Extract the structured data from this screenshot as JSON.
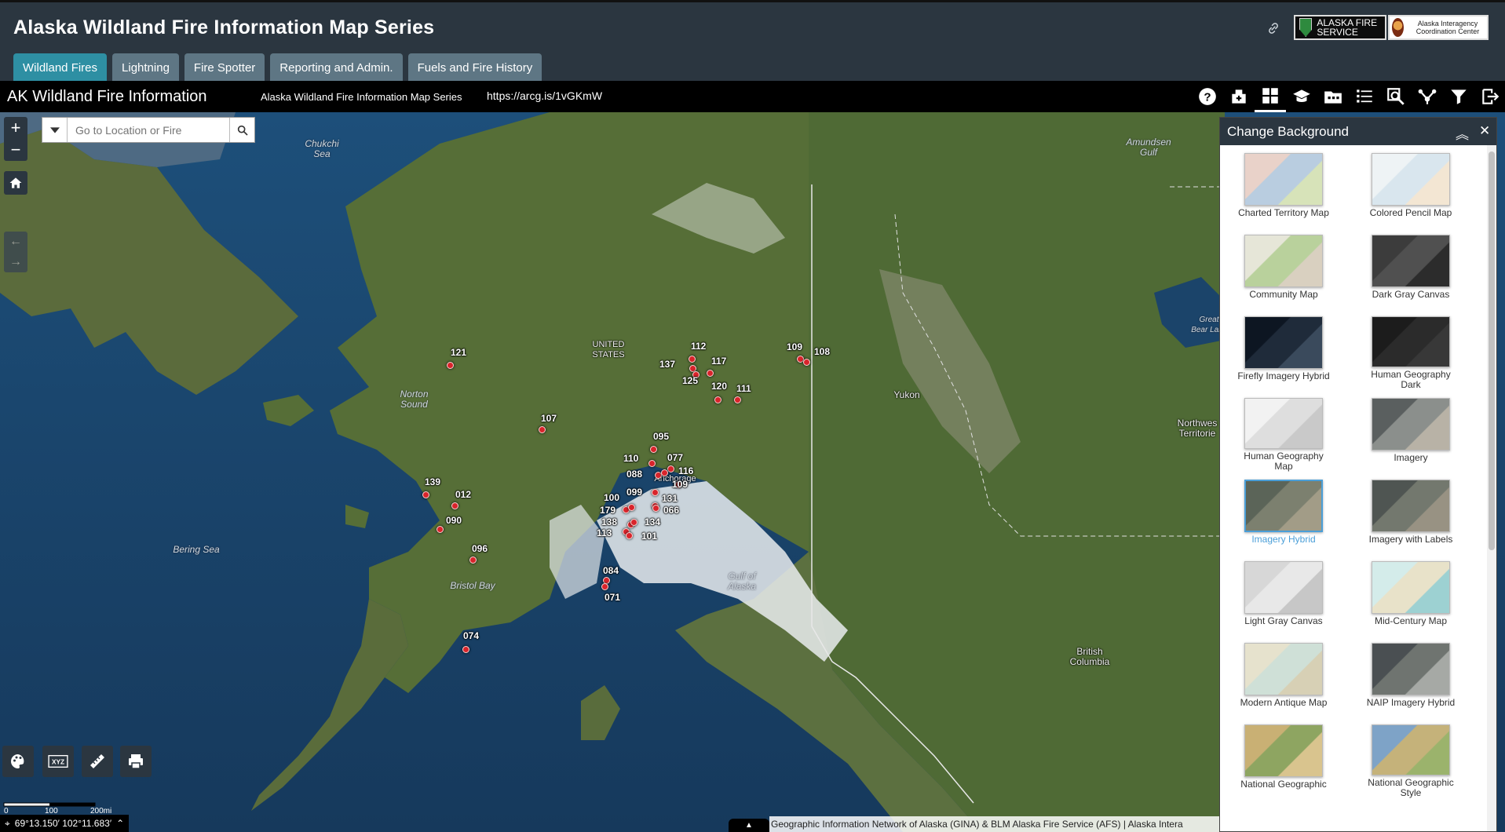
{
  "header": {
    "title": "Alaska Wildland Fire Information Map Series",
    "logo_afs": "ALASKA FIRE SERVICE",
    "logo_aicc": "Alaska Interagency Coordination Center"
  },
  "tabs": [
    {
      "label": "Wildland Fires",
      "active": true
    },
    {
      "label": "Lightning"
    },
    {
      "label": "Fire Spotter"
    },
    {
      "label": "Reporting and Admin."
    },
    {
      "label": "Fuels and Fire History"
    }
  ],
  "subbar": {
    "title": "AK Wildland Fire Information",
    "series": "Alaska Wildland Fire Information Map Series",
    "url": "https://arcg.is/1vGKmW"
  },
  "toolbar": [
    "help-icon",
    "add-data-icon",
    "basemap-gallery-icon",
    "education-icon",
    "layers-folder-icon",
    "legend-icon",
    "query-icon",
    "share-icon",
    "filter-icon",
    "export-icon"
  ],
  "search": {
    "placeholder": "Go to Location or Fire"
  },
  "map_labels": {
    "chukchi": "Chukchi\nSea",
    "amundsen": "Amundsen\nGulf",
    "us": "UNITED\nSTATES",
    "norton": "Norton\nSound",
    "yukon": "Yukon",
    "great_bear": "Great\nBear Lake",
    "northwest": "Northwes\nTerritorie",
    "bering": "Bering Sea",
    "bristol": "Bristol Bay",
    "gulf_alaska": "Gulf of\nAlaska",
    "bc": "British\nColumbia",
    "anchorage": "Anchorage"
  },
  "fires": [
    {
      "id": "121"
    },
    {
      "id": "112"
    },
    {
      "id": "109"
    },
    {
      "id": "108"
    },
    {
      "id": "137"
    },
    {
      "id": "117"
    },
    {
      "id": "125"
    },
    {
      "id": "120"
    },
    {
      "id": "111"
    },
    {
      "id": "107"
    },
    {
      "id": "095"
    },
    {
      "id": "110"
    },
    {
      "id": "077"
    },
    {
      "id": "088"
    },
    {
      "id": "116"
    },
    {
      "id": "109"
    },
    {
      "id": "139"
    },
    {
      "id": "012"
    },
    {
      "id": "100"
    },
    {
      "id": "099"
    },
    {
      "id": "131"
    },
    {
      "id": "179"
    },
    {
      "id": "066"
    },
    {
      "id": "138"
    },
    {
      "id": "134"
    },
    {
      "id": "090"
    },
    {
      "id": "113"
    },
    {
      "id": "101"
    },
    {
      "id": "096"
    },
    {
      "id": "084"
    },
    {
      "id": "071"
    },
    {
      "id": "074"
    }
  ],
  "coords": "69°13.150′ 102°11.683′",
  "scale": {
    "labels": [
      "0",
      "100",
      "200mi"
    ]
  },
  "attribution": "Geographic Information Network of Alaska (GINA) & BLM Alaska Fire Service (AFS) | Alaska Intera",
  "bottom_tools": [
    "palette-icon",
    "xyz-coordinate-icon",
    "measure-ruler-icon",
    "print-icon"
  ],
  "xyz": "XYZ",
  "panel": {
    "title": "Change Background",
    "basemaps": [
      {
        "label": "Charted Territory Map",
        "colors": [
          "#e9d2c9",
          "#b9cde0",
          "#d7e3b9"
        ]
      },
      {
        "label": "Colored Pencil Map",
        "colors": [
          "#eef3f5",
          "#d9e6ee",
          "#f3e6d3"
        ]
      },
      {
        "label": "Community Map",
        "colors": [
          "#e6e6d8",
          "#b9d19c",
          "#d9d0c0"
        ]
      },
      {
        "label": "Dark Gray Canvas",
        "colors": [
          "#3c3c3c",
          "#505050",
          "#2c2c2c"
        ]
      },
      {
        "label": "Firefly Imagery Hybrid",
        "colors": [
          "#0d1622",
          "#1f2b3a",
          "#3a4a5c"
        ]
      },
      {
        "label": "Human Geography Dark",
        "colors": [
          "#1c1c1c",
          "#2b2b2b",
          "#383838"
        ]
      },
      {
        "label": "Human Geography Map",
        "colors": [
          "#f2f2f2",
          "#dedede",
          "#c9c9c9"
        ]
      },
      {
        "label": "Imagery",
        "colors": [
          "#5a5f5f",
          "#8b8f8c",
          "#b8b2a6"
        ]
      },
      {
        "label": "Imagery Hybrid",
        "colors": [
          "#5b6458",
          "#7c806f",
          "#a29c87"
        ],
        "selected": true
      },
      {
        "label": "Imagery with Labels",
        "colors": [
          "#4f5552",
          "#73786e",
          "#989283"
        ]
      },
      {
        "label": "Light Gray Canvas",
        "colors": [
          "#d7d7d7",
          "#e8e8e8",
          "#c7c7c7"
        ]
      },
      {
        "label": "Mid-Century Map",
        "colors": [
          "#d4ecea",
          "#e8e2c9",
          "#9dd1d2"
        ]
      },
      {
        "label": "Modern Antique Map",
        "colors": [
          "#e6e2cd",
          "#cfe0d7",
          "#d7d0b5"
        ]
      },
      {
        "label": "NAIP Imagery Hybrid",
        "colors": [
          "#4a4f52",
          "#6f7470",
          "#a6a9a5"
        ]
      },
      {
        "label": "National Geographic",
        "colors": [
          "#c9b074",
          "#8ea561",
          "#d9c48e"
        ]
      },
      {
        "label": "National Geographic Style",
        "colors": [
          "#7ea3c7",
          "#c5b27a",
          "#9bb36c"
        ]
      }
    ]
  }
}
